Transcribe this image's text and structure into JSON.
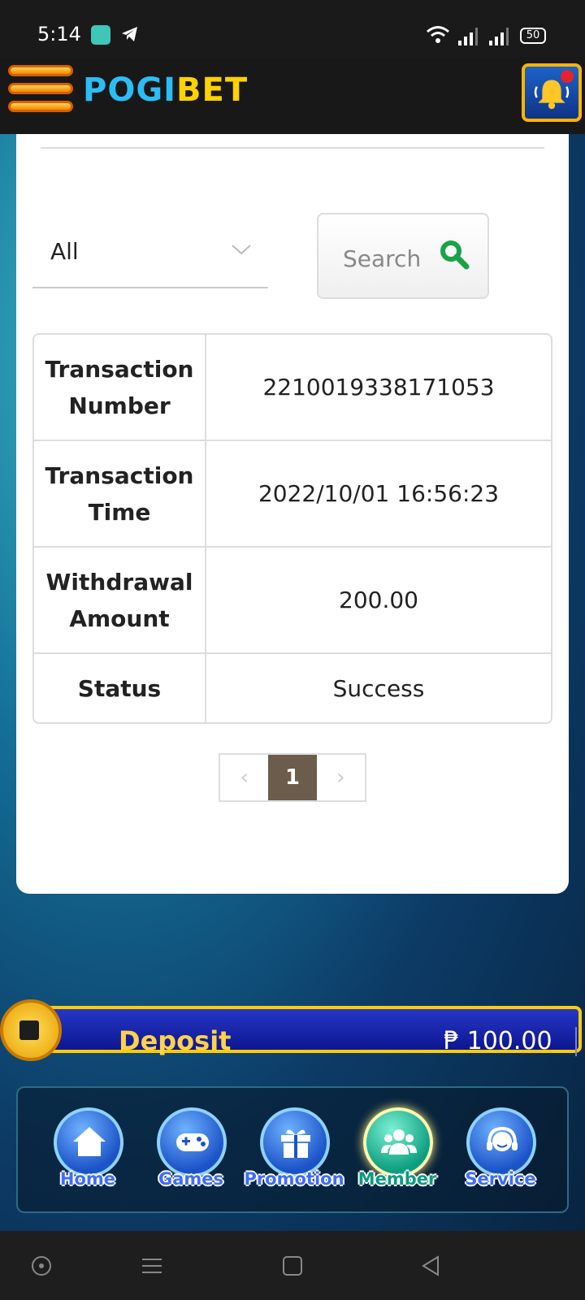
{
  "status_bar": {
    "time": "5:14",
    "battery": "50"
  },
  "header": {
    "logo_part1": "POGI",
    "logo_part2": "BET"
  },
  "filter": {
    "selected": "All",
    "search_label": "Search"
  },
  "table": {
    "rows": [
      {
        "key": "Transaction Number",
        "value": "2210019338171053"
      },
      {
        "key": "Transaction Time",
        "value": "2022/10/01 16:56:23"
      },
      {
        "key": "Withdrawal Amount",
        "value": "200.00"
      },
      {
        "key": "Status",
        "value": "Success"
      }
    ]
  },
  "pagination": {
    "prev": "‹",
    "current": "1",
    "next": "›"
  },
  "deposit": {
    "label": "Deposit",
    "amount": "₱ 100.00"
  },
  "bottom_nav": [
    {
      "label": "Home",
      "icon": "home-icon"
    },
    {
      "label": "Games",
      "icon": "gamepad-icon"
    },
    {
      "label": "Promotion",
      "icon": "gift-icon"
    },
    {
      "label": "Member",
      "icon": "members-icon"
    },
    {
      "label": "Service",
      "icon": "headset-icon"
    }
  ],
  "colors": {
    "accent": "#ffcc00",
    "search_icon": "#1aa34a",
    "pager_active": "#6c5c4c"
  }
}
